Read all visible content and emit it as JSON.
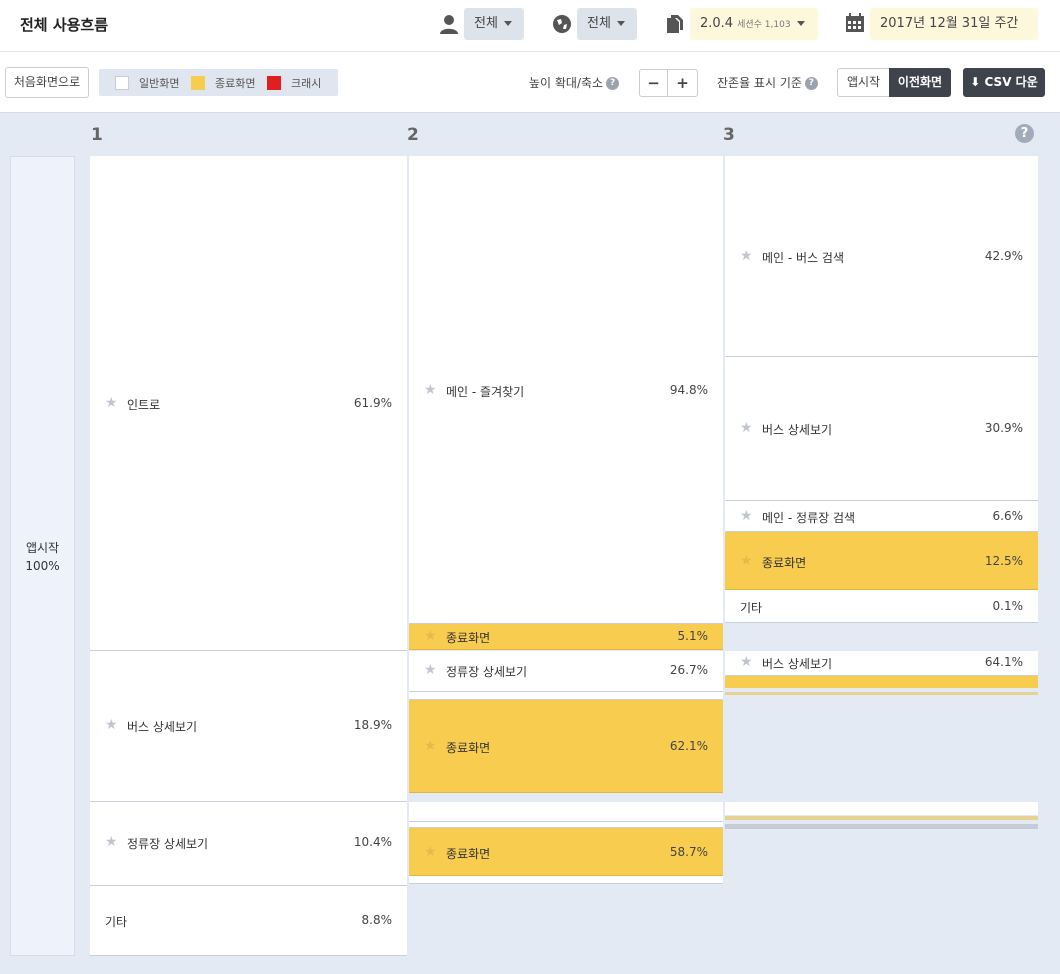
{
  "header": {
    "title": "전체 사용흐름",
    "user_filter": "전체",
    "region_filter": "전체",
    "version": "2.0.4",
    "sessions_label": "세션수 1,103",
    "date_range": "2017년 12월 31일 주간"
  },
  "toolbar": {
    "reset_button": "처음화면으로",
    "legend": [
      {
        "label": "일반화면",
        "color": "#ffffff"
      },
      {
        "label": "종료화면",
        "color": "#f8cd4f"
      },
      {
        "label": "크래시",
        "color": "#e02020"
      }
    ],
    "zoom_label": "높이 확대/축소",
    "zoom_out": "−",
    "zoom_in": "+",
    "retention_label": "잔존율 표시 기준",
    "retention_options": [
      "앱시작",
      "이전화면"
    ],
    "retention_selected": "이전화면",
    "csv_button": "CSV 다운"
  },
  "flow": {
    "columns": [
      "1",
      "2",
      "3"
    ],
    "start": {
      "label": "앱시작",
      "pct": "100%"
    },
    "col1": [
      {
        "label": "인트로",
        "pct": "61.9%"
      },
      {
        "label": "버스 상세보기",
        "pct": "18.9%"
      },
      {
        "label": "정류장 상세보기",
        "pct": "10.4%"
      },
      {
        "label": "기타",
        "pct": "8.8%"
      }
    ],
    "col2": [
      {
        "label": "메인 - 즐겨찾기",
        "pct": "94.8%"
      },
      {
        "label": "종료화면",
        "pct": "5.1%"
      },
      {
        "label": "정류장 상세보기",
        "pct": "26.7%"
      },
      {
        "label": "종료화면",
        "pct": "62.1%"
      },
      {
        "label": "종료화면",
        "pct": "58.7%"
      }
    ],
    "col3": [
      {
        "label": "메인 - 버스 검색",
        "pct": "42.9%"
      },
      {
        "label": "버스 상세보기",
        "pct": "30.9%"
      },
      {
        "label": "메인 - 정류장 검색",
        "pct": "6.6%"
      },
      {
        "label": "종료화면",
        "pct": "12.5%"
      },
      {
        "label": "기타",
        "pct": "0.1%"
      },
      {
        "label": "버스 상세보기",
        "pct": "64.1%"
      }
    ]
  }
}
